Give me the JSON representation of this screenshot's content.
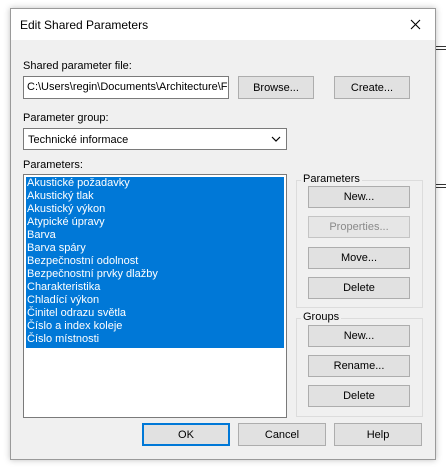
{
  "dialog": {
    "title": "Edit Shared Parameters",
    "close_icon": "close-icon"
  },
  "shared_file": {
    "label": "Shared parameter file:",
    "value": "C:\\Users\\regin\\Documents\\Architecture\\F",
    "browse_label": "Browse...",
    "create_label": "Create..."
  },
  "param_group": {
    "label": "Parameter group:",
    "selected": "Technické informace",
    "chevron_icon": "chevron-down-icon"
  },
  "parameters": {
    "label": "Parameters:",
    "items": [
      "Akustické požadavky",
      "Akustický tlak",
      "Akustický výkon",
      "Atypické úpravy",
      "Barva",
      "Barva spáry",
      "Bezpečnostní odolnost",
      "Bezpečnostní prvky dlažby",
      "Charakteristika",
      "Chladící výkon",
      "Činitel odrazu světla",
      "Číslo a index koleje",
      "Číslo místnosti"
    ]
  },
  "parameters_box": {
    "title": "Parameters",
    "new_label": "New...",
    "properties_label": "Properties...",
    "move_label": "Move...",
    "delete_label": "Delete"
  },
  "groups_box": {
    "title": "Groups",
    "new_label": "New...",
    "rename_label": "Rename...",
    "delete_label": "Delete"
  },
  "footer": {
    "ok_label": "OK",
    "cancel_label": "Cancel",
    "help_label": "Help"
  },
  "colors": {
    "selection": "#0078d7",
    "default_button_border": "#0078d7",
    "dialog_bg": "#f0f0f0"
  }
}
